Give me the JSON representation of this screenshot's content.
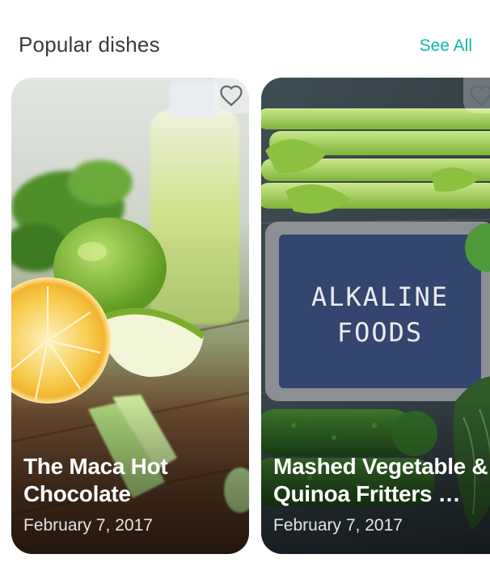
{
  "section": {
    "title": "Popular dishes",
    "see_all_label": "See All"
  },
  "cards": [
    {
      "title": "The Maca Hot Chocolate",
      "date": "February 7, 2017",
      "favorite_icon": "heart-outline-icon",
      "image": "green-juice-lemon-apple-photo"
    },
    {
      "title": "Mashed Vegetable & Quinoa Fritters …",
      "date": "February 7, 2017",
      "favorite_icon": "heart-outline-icon",
      "image": "alkaline-foods-chalkboard-photo",
      "image_text": "ALKALINE FOODS"
    }
  ],
  "colors": {
    "accent": "#10b8a8",
    "title": "#3a3a3a"
  }
}
